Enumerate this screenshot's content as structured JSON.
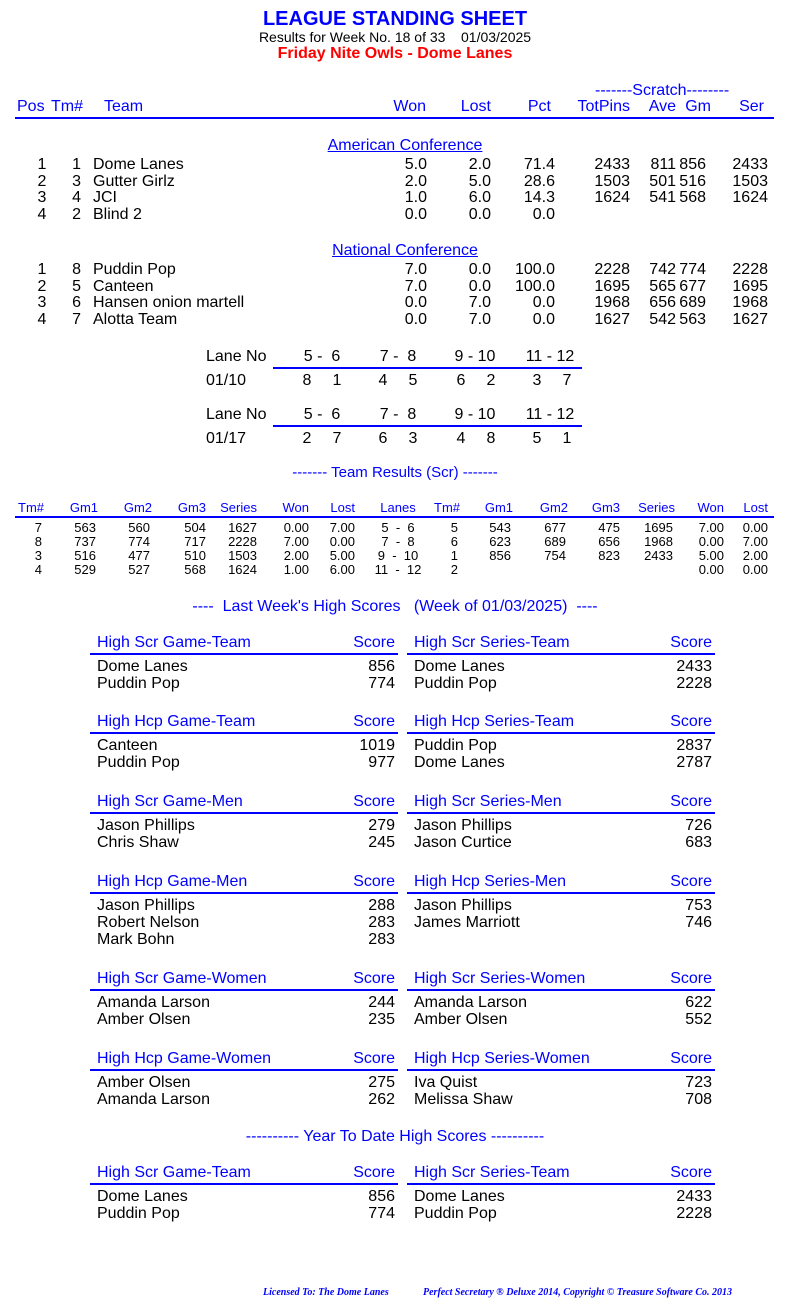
{
  "header": {
    "title": "LEAGUE STANDING SHEET",
    "subtitle": "Results for Week No. 18 of 33    01/03/2025",
    "league": "Friday Nite Owls - Dome Lanes"
  },
  "standings": {
    "scratch_label": "-------Scratch--------",
    "columns": [
      "Pos",
      "Tm#",
      "Team",
      "Won",
      "Lost",
      "Pct",
      "TotPins",
      "Ave",
      "Gm",
      "Ser"
    ],
    "conferences": [
      {
        "name": "American Conference",
        "rows": [
          [
            "1",
            "1",
            "Dome Lanes",
            "5.0",
            "2.0",
            "71.4",
            "2433",
            "811",
            "856",
            "2433"
          ],
          [
            "2",
            "3",
            "Gutter Girlz",
            "2.0",
            "5.0",
            "28.6",
            "1503",
            "501",
            "516",
            "1503"
          ],
          [
            "3",
            "4",
            "JCI",
            "1.0",
            "6.0",
            "14.3",
            "1624",
            "541",
            "568",
            "1624"
          ],
          [
            "4",
            "2",
            "Blind 2",
            "0.0",
            "0.0",
            "0.0",
            "",
            "",
            "",
            ""
          ]
        ]
      },
      {
        "name": "National Conference",
        "rows": [
          [
            "1",
            "8",
            "Puddin Pop",
            "7.0",
            "0.0",
            "100.0",
            "2228",
            "742",
            "774",
            "2228"
          ],
          [
            "2",
            "5",
            "Canteen",
            "7.0",
            "0.0",
            "100.0",
            "1695",
            "565",
            "677",
            "1695"
          ],
          [
            "3",
            "6",
            "Hansen onion martell",
            "0.0",
            "7.0",
            "0.0",
            "1968",
            "656",
            "689",
            "1968"
          ],
          [
            "4",
            "7",
            "Alotta Team",
            "0.0",
            "7.0",
            "0.0",
            "1627",
            "542",
            "563",
            "1627"
          ]
        ]
      }
    ]
  },
  "schedule": {
    "lane_label": "Lane No",
    "lanes": [
      "5 -  6",
      "7 -  8",
      "9 - 10",
      "11 - 12"
    ],
    "weeks": [
      {
        "date": "01/10",
        "pairs": [
          [
            "8",
            "1"
          ],
          [
            "4",
            "5"
          ],
          [
            "6",
            "2"
          ],
          [
            "3",
            "7"
          ]
        ]
      },
      {
        "date": "01/17",
        "pairs": [
          [
            "2",
            "7"
          ],
          [
            "6",
            "3"
          ],
          [
            "4",
            "8"
          ],
          [
            "5",
            "1"
          ]
        ]
      }
    ]
  },
  "team_results": {
    "title": "------- Team Results (Scr) -------",
    "columns": [
      "Tm#",
      "Gm1",
      "Gm2",
      "Gm3",
      "Series",
      "Won",
      "Lost",
      "Lanes",
      "Tm#",
      "Gm1",
      "Gm2",
      "Gm3",
      "Series",
      "Won",
      "Lost"
    ],
    "rows": [
      [
        "7",
        "563",
        "560",
        "504",
        "1627",
        "0.00",
        "7.00",
        "5  -  6",
        "5",
        "543",
        "677",
        "475",
        "1695",
        "7.00",
        "0.00"
      ],
      [
        "8",
        "737",
        "774",
        "717",
        "2228",
        "7.00",
        "0.00",
        "7  -  8",
        "6",
        "623",
        "689",
        "656",
        "1968",
        "0.00",
        "7.00"
      ],
      [
        "3",
        "516",
        "477",
        "510",
        "1503",
        "2.00",
        "5.00",
        "9  -  10",
        "1",
        "856",
        "754",
        "823",
        "2433",
        "5.00",
        "2.00"
      ],
      [
        "4",
        "529",
        "527",
        "568",
        "1624",
        "1.00",
        "6.00",
        "11  -  12",
        "2",
        "",
        "",
        "",
        "",
        "0.00",
        "0.00"
      ]
    ]
  },
  "last_week": {
    "title": "----  Last Week's High Scores   (Week of 01/03/2025)  ----",
    "score_label": "Score",
    "pairs": [
      [
        {
          "title": "High Scr Game-Team",
          "rows": [
            [
              "Dome Lanes",
              "856"
            ],
            [
              "Puddin Pop",
              "774"
            ]
          ]
        },
        {
          "title": "High Scr Series-Team",
          "rows": [
            [
              "Dome Lanes",
              "2433"
            ],
            [
              "Puddin Pop",
              "2228"
            ]
          ]
        }
      ],
      [
        {
          "title": "High Hcp Game-Team",
          "rows": [
            [
              "Canteen",
              "1019"
            ],
            [
              "Puddin Pop",
              "977"
            ]
          ]
        },
        {
          "title": "High Hcp Series-Team",
          "rows": [
            [
              "Puddin Pop",
              "2837"
            ],
            [
              "Dome Lanes",
              "2787"
            ]
          ]
        }
      ],
      [
        {
          "title": "High Scr Game-Men",
          "rows": [
            [
              "Jason Phillips",
              "279"
            ],
            [
              "Chris Shaw",
              "245"
            ]
          ]
        },
        {
          "title": "High Scr Series-Men",
          "rows": [
            [
              "Jason Phillips",
              "726"
            ],
            [
              "Jason Curtice",
              "683"
            ]
          ]
        }
      ],
      [
        {
          "title": "High Hcp Game-Men",
          "rows": [
            [
              "Jason Phillips",
              "288"
            ],
            [
              "Robert Nelson",
              "283"
            ],
            [
              "Mark Bohn",
              "283"
            ]
          ]
        },
        {
          "title": "High Hcp Series-Men",
          "rows": [
            [
              "Jason Phillips",
              "753"
            ],
            [
              "James Marriott",
              "746"
            ]
          ]
        }
      ],
      [
        {
          "title": "High Scr Game-Women",
          "rows": [
            [
              "Amanda Larson",
              "244"
            ],
            [
              "Amber Olsen",
              "235"
            ]
          ]
        },
        {
          "title": "High Scr Series-Women",
          "rows": [
            [
              "Amanda Larson",
              "622"
            ],
            [
              "Amber Olsen",
              "552"
            ]
          ]
        }
      ],
      [
        {
          "title": "High Hcp Game-Women",
          "rows": [
            [
              "Amber Olsen",
              "275"
            ],
            [
              "Amanda Larson",
              "262"
            ]
          ]
        },
        {
          "title": "High Hcp Series-Women",
          "rows": [
            [
              "Iva Quist",
              "723"
            ],
            [
              "Melissa Shaw",
              "708"
            ]
          ]
        }
      ]
    ]
  },
  "ytd": {
    "title": "---------- Year To Date High Scores ----------",
    "pairs": [
      [
        {
          "title": "High Scr Game-Team",
          "rows": [
            [
              "Dome Lanes",
              "856"
            ],
            [
              "Puddin Pop",
              "774"
            ]
          ]
        },
        {
          "title": "High Scr Series-Team",
          "rows": [
            [
              "Dome Lanes",
              "2433"
            ],
            [
              "Puddin Pop",
              "2228"
            ]
          ]
        }
      ]
    ]
  },
  "footer": {
    "license": "Licensed To: The Dome Lanes",
    "copyright": "Perfect Secretary ® Deluxe  2014, Copyright © Treasure Software Co. 2013"
  },
  "colors": {
    "accent": "#0000ff",
    "league": "#ff0000"
  }
}
